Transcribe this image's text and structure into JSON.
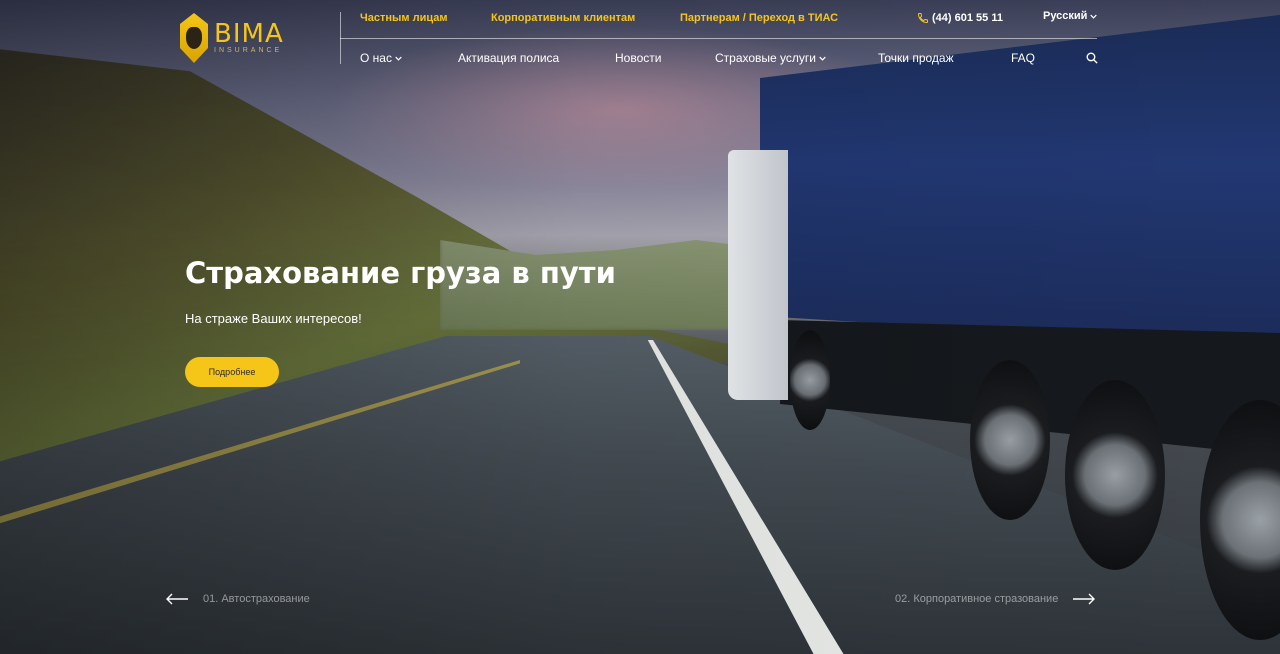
{
  "logo": {
    "name": "BIMA",
    "sub": "INSURANCE"
  },
  "top_links": [
    {
      "label": "Частным лицам"
    },
    {
      "label": "Корпоративным клиентам"
    },
    {
      "label": "Партнерам / Переход в ТИАС"
    }
  ],
  "phone": {
    "number": "(44) 601 55 11",
    "icon": "phone-icon"
  },
  "language": {
    "selected": "Русский",
    "icon": "chevron-down-icon"
  },
  "nav": [
    {
      "label": "О нас",
      "has_dropdown": true
    },
    {
      "label": "Активация полиса",
      "has_dropdown": false
    },
    {
      "label": "Новости",
      "has_dropdown": false
    },
    {
      "label": "Страховые услуги",
      "has_dropdown": true
    },
    {
      "label": "Точки продаж",
      "has_dropdown": false
    },
    {
      "label": "FAQ",
      "has_dropdown": false
    }
  ],
  "search": {
    "icon": "search-icon"
  },
  "hero": {
    "title": "Страхование груза в пути",
    "subtitle": "На страже Ваших интересов!",
    "button": "Подробнее"
  },
  "slider": {
    "prev": "01. Автострахование",
    "next": "02. Корпоративное стразование"
  },
  "colors": {
    "accent": "#f5c518",
    "text": "#ffffff"
  }
}
